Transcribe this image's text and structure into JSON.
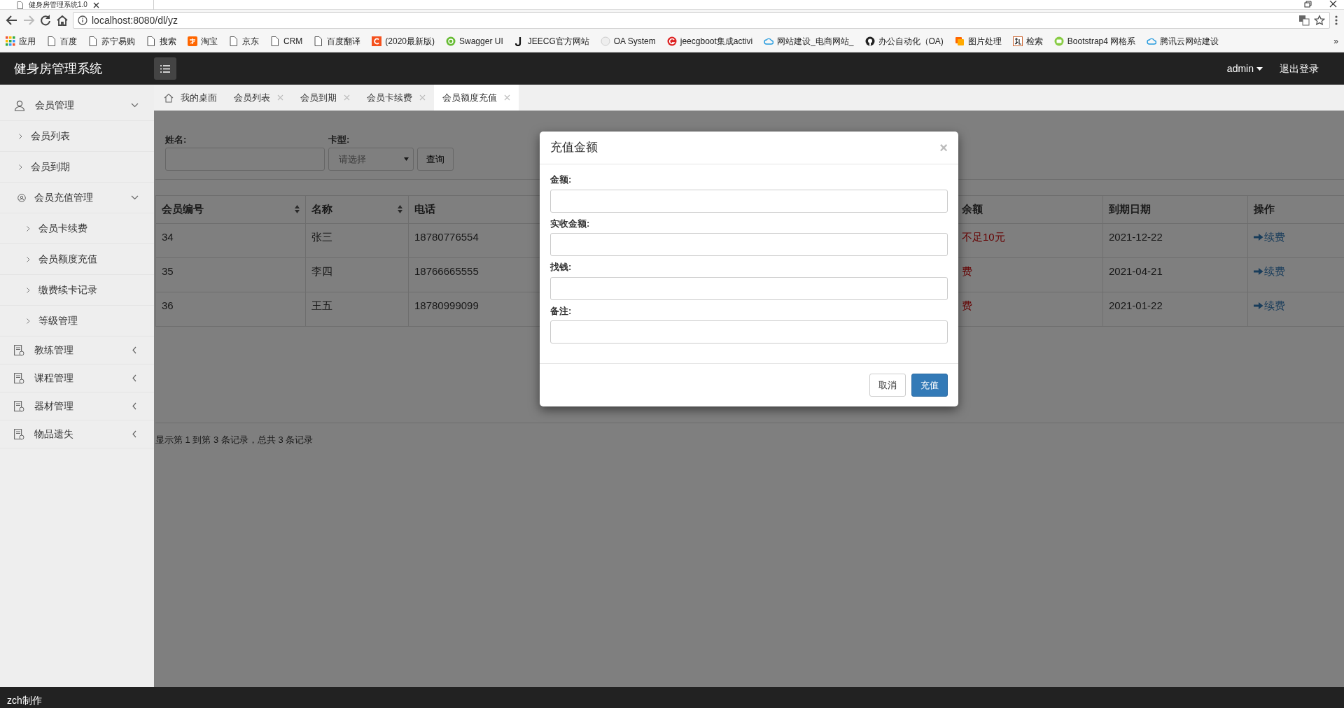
{
  "browser": {
    "tab_title": "健身房管理系统1.0",
    "url": "localhost:8080/dl/yz",
    "more": "»",
    "bookmarks": [
      {
        "label": "应用",
        "kind": "apps"
      },
      {
        "label": "百度",
        "kind": "page"
      },
      {
        "label": "苏宁易购",
        "kind": "page"
      },
      {
        "label": "搜索",
        "kind": "page"
      },
      {
        "label": "淘宝",
        "kind": "tao"
      },
      {
        "label": "京东",
        "kind": "page"
      },
      {
        "label": "CRM",
        "kind": "page"
      },
      {
        "label": "百度翻译",
        "kind": "page"
      },
      {
        "label": "(2020最新版)",
        "kind": "c"
      },
      {
        "label": "Swagger UI",
        "kind": "swagger"
      },
      {
        "label": "JEECG官方网站",
        "kind": "j"
      },
      {
        "label": "OA System",
        "kind": "oa"
      },
      {
        "label": "jeecgboot集成activi",
        "kind": "g"
      },
      {
        "label": "网站建设_电商网站_",
        "kind": "cloud"
      },
      {
        "label": "办公自动化（OA)",
        "kind": "github"
      },
      {
        "label": "图片处理",
        "kind": "image"
      },
      {
        "label": "检索",
        "kind": "zhi"
      },
      {
        "label": "Bootstrap4 网格系",
        "kind": "bootstrap"
      },
      {
        "label": "腾讯云网站建设",
        "kind": "cloud"
      }
    ]
  },
  "app": {
    "brand": "健身房管理系统",
    "user": "admin",
    "logout": "退出登录"
  },
  "sidebar": {
    "items": [
      {
        "label": "会员管理",
        "kind": "user",
        "expanded": true,
        "children": [
          {
            "label": "会员列表"
          },
          {
            "label": "会员到期"
          },
          {
            "label": "会员充值管理",
            "kind": "user-circle",
            "expanded": true,
            "children": [
              {
                "label": "会员卡续费"
              },
              {
                "label": "会员额度充值"
              },
              {
                "label": "缴费续卡记录"
              },
              {
                "label": "等级管理"
              }
            ]
          }
        ]
      },
      {
        "label": "教练管理",
        "kind": "doc",
        "expanded": false
      },
      {
        "label": "课程管理",
        "kind": "doc",
        "expanded": false
      },
      {
        "label": "器材管理",
        "kind": "doc",
        "expanded": false
      },
      {
        "label": "物品遗失",
        "kind": "doc",
        "expanded": false
      }
    ]
  },
  "tabs": [
    {
      "label": "我的桌面",
      "kind": "home",
      "selected": false
    },
    {
      "label": "会员列表",
      "kind": "closable",
      "selected": false
    },
    {
      "label": "会员到期",
      "kind": "closable",
      "selected": false
    },
    {
      "label": "会员卡续费",
      "kind": "closable",
      "selected": false
    },
    {
      "label": "会员额度充值",
      "kind": "closable",
      "selected": true
    }
  ],
  "filter": {
    "fields": [
      {
        "label": "姓名:",
        "kind": "text"
      },
      {
        "label": "卡型:",
        "kind": "select",
        "value": "请选择"
      }
    ],
    "button": "查询"
  },
  "table": {
    "columns": [
      {
        "label": "会员编号",
        "sortable": true,
        "kind": "text"
      },
      {
        "label": "名称",
        "sortable": true,
        "kind": "text"
      },
      {
        "label": "电话",
        "kind": "text"
      },
      {
        "label": "余额",
        "kind": "alert"
      },
      {
        "label": "到期日期",
        "kind": "text"
      },
      {
        "label": "操作",
        "kind": "link"
      }
    ],
    "rows": [
      [
        "34",
        "张三",
        "18780776554",
        "不足10元",
        "2021-12-22",
        "续费"
      ],
      [
        "35",
        "李四",
        "18766665555",
        "费",
        "2021-04-21",
        "续费"
      ],
      [
        "36",
        "王五",
        "18780999099",
        "费",
        "2021-01-22",
        "续费"
      ]
    ]
  },
  "pagination": "显示第 1 到第 3 条记录，总共 3 条记录",
  "modal": {
    "title": "充值金额",
    "close": "×",
    "fields": [
      "金额:",
      "实收金额:",
      "找钱:",
      "备注:"
    ],
    "buttons": [
      {
        "label": "取消",
        "kind": "default"
      },
      {
        "label": "充值",
        "kind": "primary"
      }
    ]
  },
  "footer": "zch制作"
}
